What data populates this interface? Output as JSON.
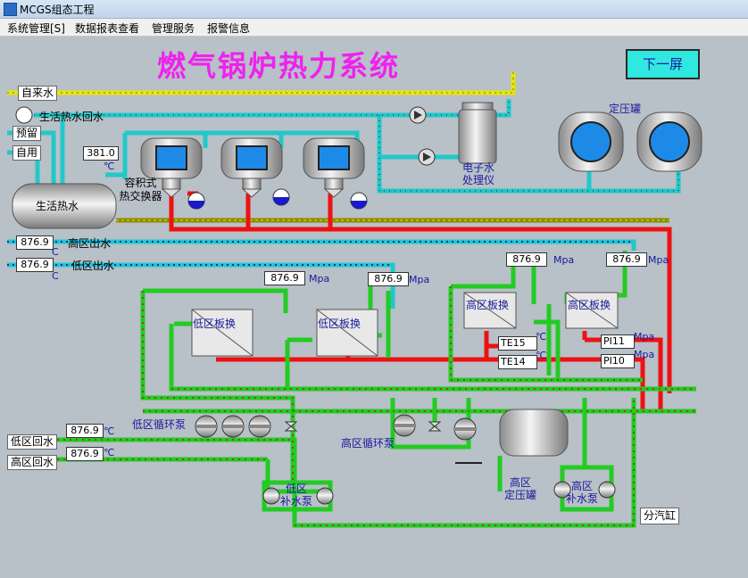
{
  "window": {
    "title": "MCGS组态工程"
  },
  "menu": [
    "系统管理[S]",
    "数据报表查看",
    "管理服务",
    "报警信息"
  ],
  "header": {
    "title": "燃气锅炉热力系统",
    "next_button": "下一屏"
  },
  "labels": {
    "tap_water": "自来水",
    "hot_return": "生活热水回水",
    "reserve": "预留",
    "self_use": "自用",
    "hot_water": "生活热水",
    "storage_exchanger": "容积式\n热交换器",
    "edi": "电子水\n处理仪",
    "const_pressure_tank": "定压罐",
    "hi_out": "高区出水",
    "lo_out": "低区出水",
    "lo_plate_1": "低区板换",
    "lo_plate_2": "低区板换",
    "hi_plate_1": "高区板换",
    "hi_plate_2": "高区板换",
    "lo_circ_pump": "低区循环泵",
    "hi_circ_pump": "高区循环泵",
    "lo_return": "低区回水",
    "hi_return": "高区回水",
    "lo_makeup": "低区\n补水泵",
    "hi_makeup": "高区\n补水泵",
    "hi_const_tank": "高区\n定压罐",
    "steam_header": "分汽缸",
    "te15": "TE15",
    "te14": "TE14",
    "pi11": "PI11",
    "pi10": "PI10"
  },
  "readings": {
    "tank_temp": "381.0",
    "hi_out_temp": "876.9",
    "lo_out_temp": "876.9",
    "p1": "876.9",
    "p2": "876.9",
    "p3": "876.9",
    "p4": "876.9",
    "lo_return_temp": "876.9",
    "hi_return_temp": "876.9"
  },
  "units": {
    "c": "℃",
    "c_short": "C",
    "mpa": "Mpa"
  },
  "colors": {
    "green_pipe": "#22cc22",
    "red_pipe": "#ee1111",
    "cyan_pipe": "#22c8c8",
    "title": "#ee22ee",
    "button": "#30e8e0"
  }
}
